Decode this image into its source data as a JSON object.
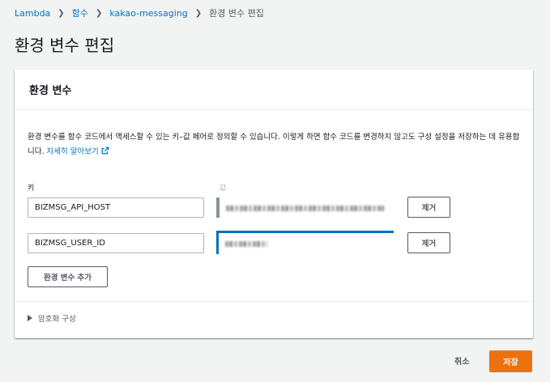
{
  "breadcrumb": {
    "items": [
      "Lambda",
      "함수",
      "kakao-messaging"
    ],
    "current": "환경 변수 편집"
  },
  "page_title": "환경 변수 편집",
  "panel": {
    "header": "환경 변수",
    "description": "환경 변수를 함수 코드에서 액세스할 수 있는 키–값 페어로 정의할 수 있습니다. 이렇게 하면 함수 코드를 변경하지 않고도 구성 설정을 저장하는 데 유용합니다.",
    "learn_more": "자세히 알아보기",
    "key_label": "키",
    "value_label": "값",
    "rows": [
      {
        "key": "BIZMSG_API_HOST",
        "remove_label": "제거"
      },
      {
        "key": "BIZMSG_USER_ID",
        "remove_label": "제거"
      }
    ],
    "add_button": "환경 변수 추가",
    "encryption_label": "암호화 구성"
  },
  "footer": {
    "cancel": "취소",
    "save": "저장"
  },
  "colors": {
    "link": "#0073bb",
    "primary_button": "#ec7211",
    "focus": "#0073bb"
  }
}
